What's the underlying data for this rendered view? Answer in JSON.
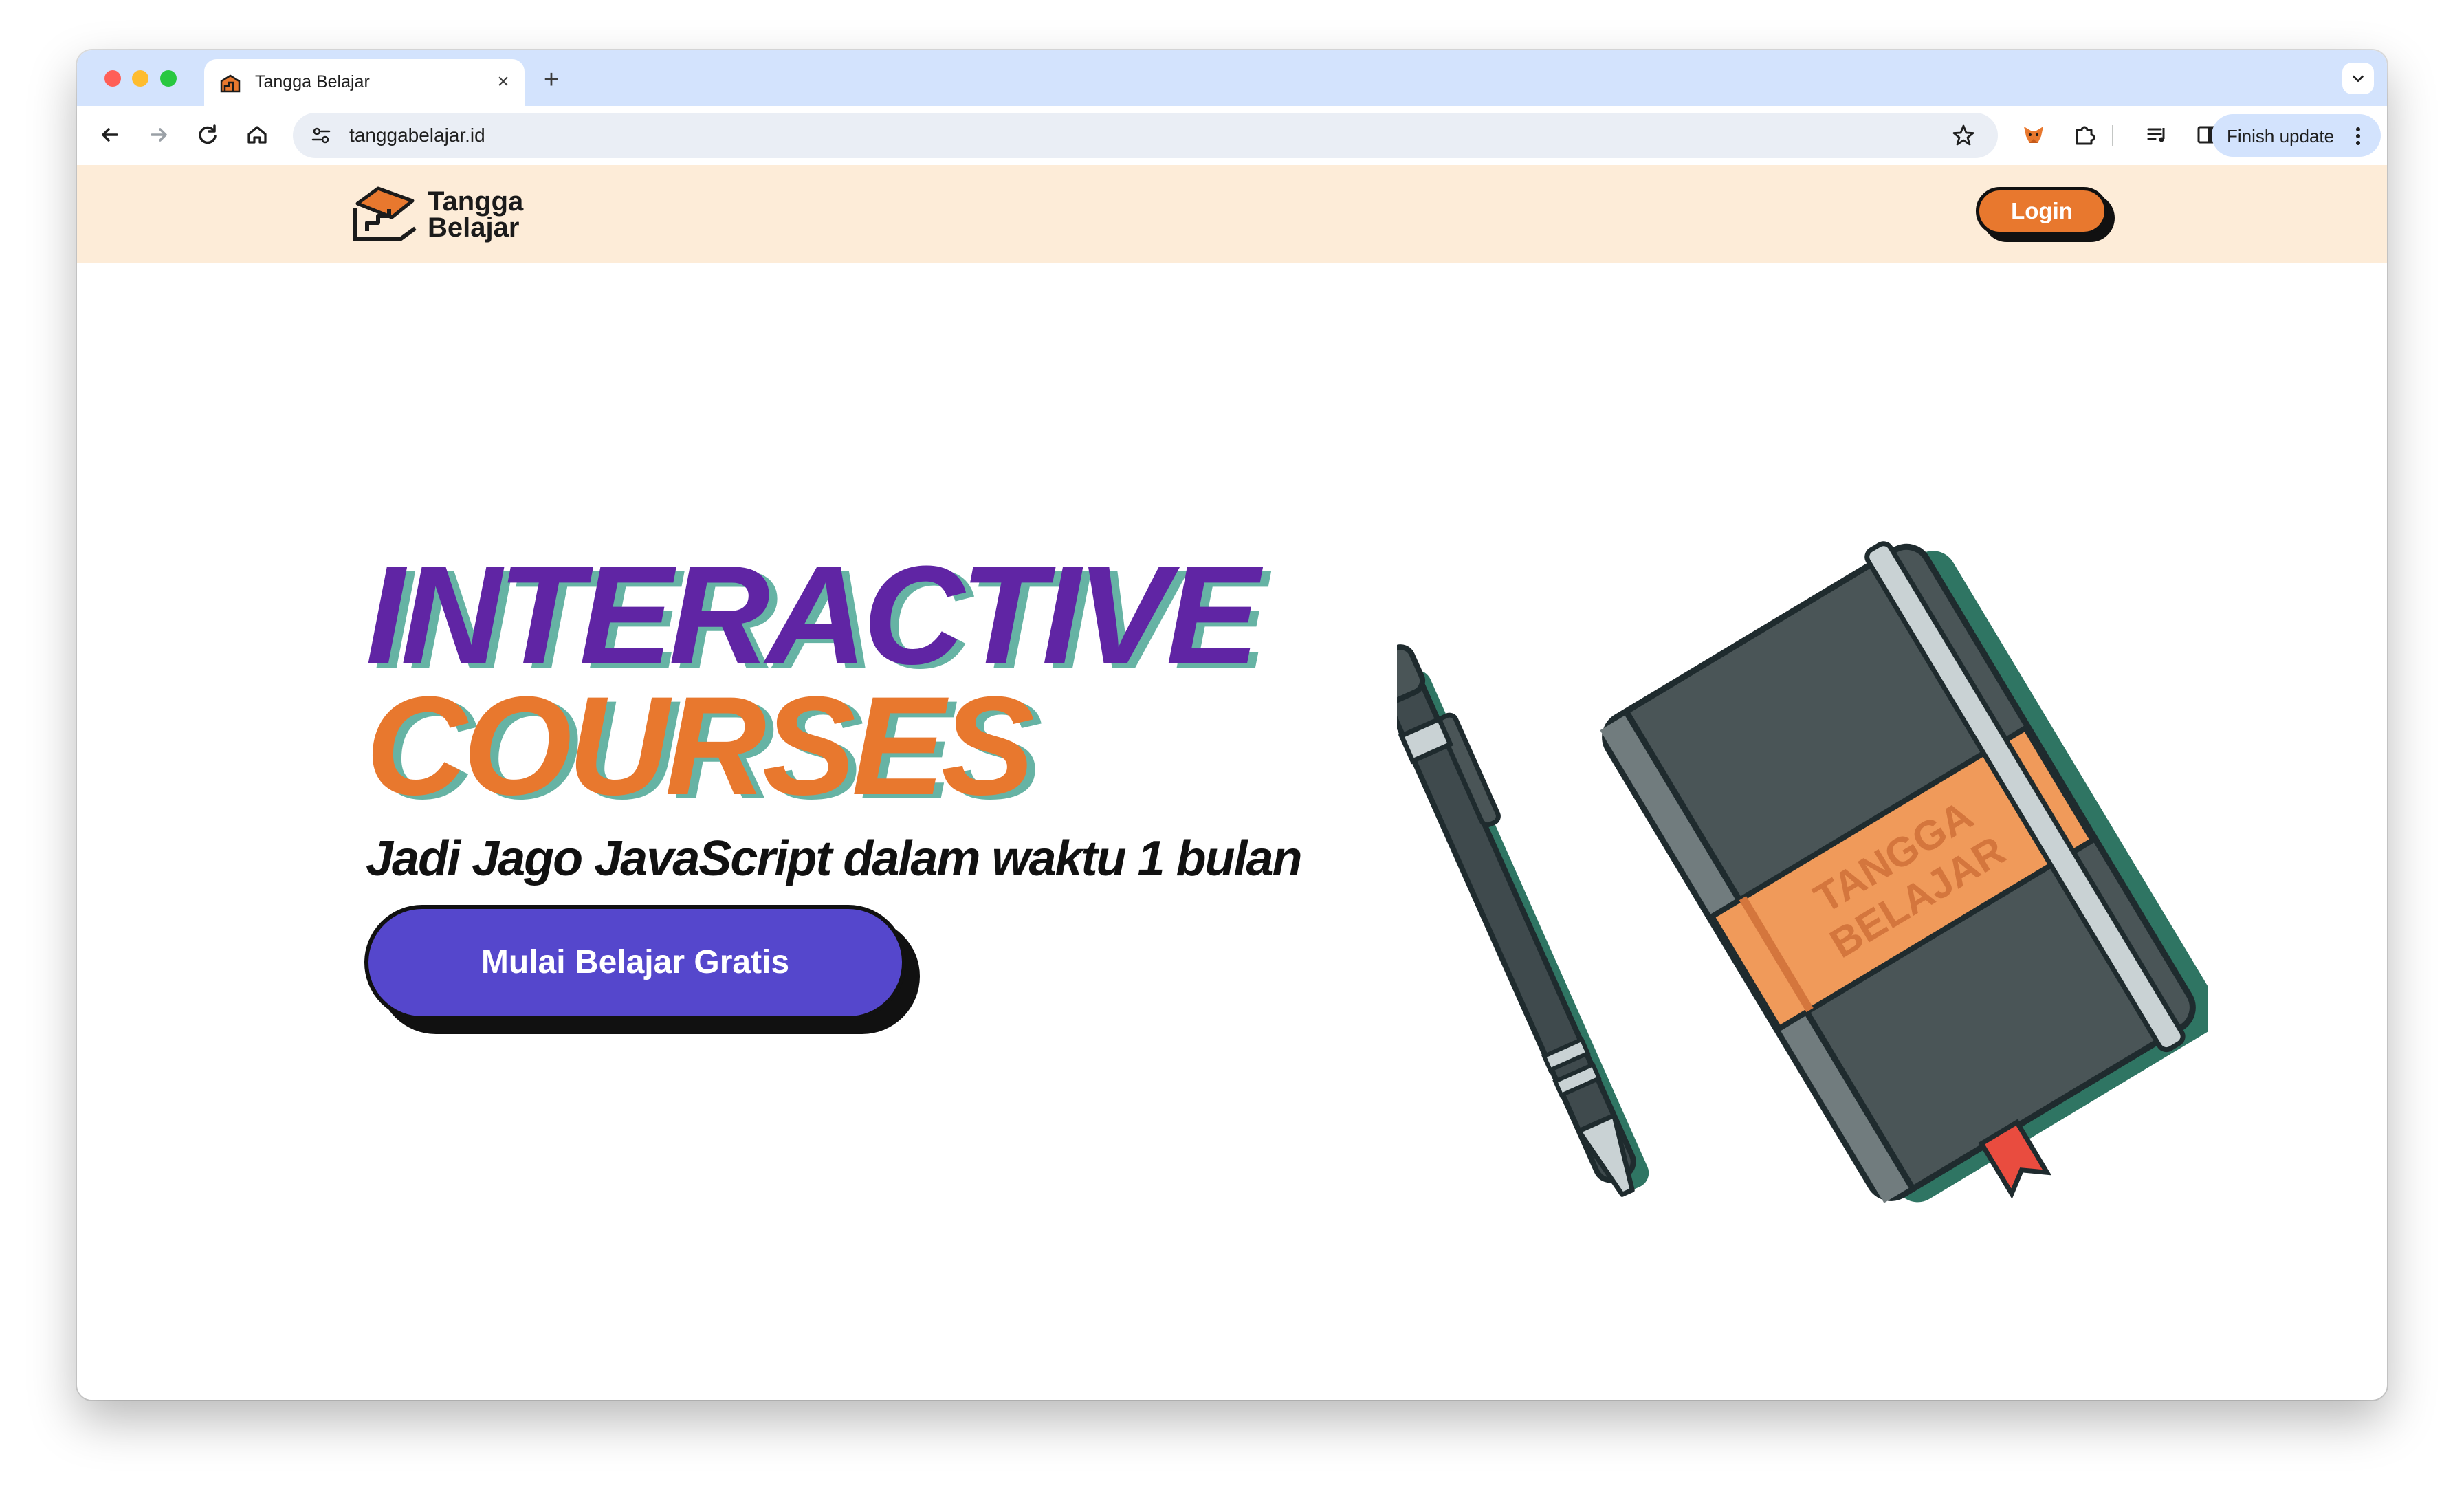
{
  "browser": {
    "tab_title": "Tangga Belajar",
    "tab_close": "×",
    "new_tab": "+",
    "url": "tanggabelajar.id",
    "finish_update_label": "Finish update"
  },
  "site": {
    "logo_line1": "Tangga",
    "logo_line2": "Belajar",
    "login_label": "Login"
  },
  "hero": {
    "title_line1": "INTERACTIVE",
    "title_line2": "COURSES",
    "subtitle": "Jadi Jago JavaScript dalam waktu 1 bulan",
    "cta_label": "Mulai Belajar Gratis",
    "notebook_label_line1": "TANGGA",
    "notebook_label_line2": "BELAJAR"
  },
  "colors": {
    "purple": "#6025a4",
    "orange": "#e8782e",
    "teal_shadow": "#66b3a4",
    "cta_blue": "#5547cc",
    "header_bg": "#fdecd8"
  },
  "icons": {
    "back": "back-arrow-icon",
    "forward": "forward-arrow-icon",
    "reload": "reload-icon",
    "home": "home-icon",
    "site_info": "tune-icon",
    "bookmark": "star-icon",
    "extension_fox": "fox-extension-icon",
    "extensions": "puzzle-icon",
    "media": "media-control-icon",
    "side_panel": "side-panel-icon",
    "profile": "avatar",
    "menu": "more-vertical-icon"
  }
}
